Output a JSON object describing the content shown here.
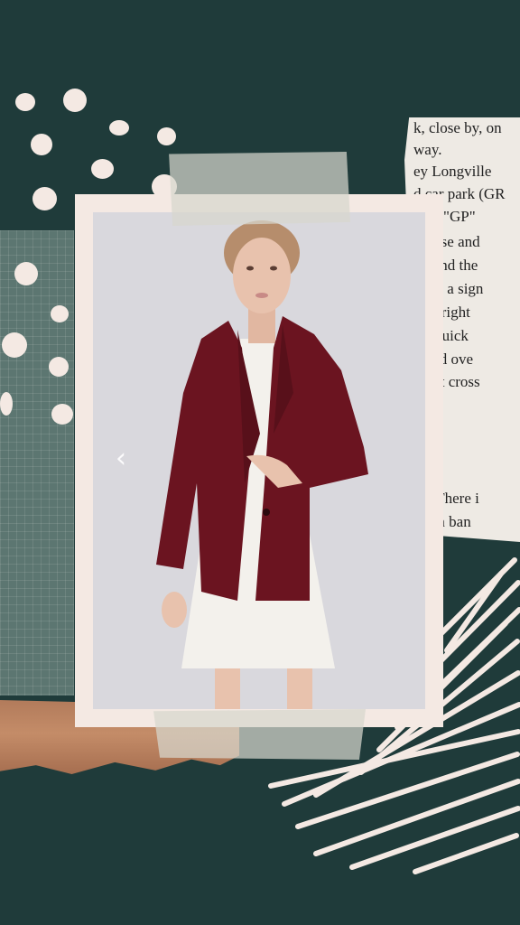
{
  "newspaper": {
    "lines_top": [
      "k, close by, on",
      "way.",
      "ey Longville",
      "d car park (GR",
      "nap, \"GP\"",
      "f these and",
      "ascend the",
      "meet a sign",
      "half right",
      "(in quick",
      "n and ove",
      "o not cross"
    ],
    "lines_bottom": [
      "ge. There i",
      "thern ban"
    ]
  },
  "photo": {
    "icon": "model-in-burgundy-velvet-blazer-photo",
    "colors": {
      "backdrop": "#d9d8dd",
      "blazer": "#6b1420",
      "dress": "#f3f1ec",
      "skin": "#e8c2ad",
      "hair": "#b68d6c"
    }
  },
  "controls": {
    "prev_icon": "chevron-left-icon",
    "prev_glyph": "‹"
  },
  "palette": {
    "background": "#1f3b3a",
    "accent_cream": "#f4e9e3",
    "copper": "#b27b5b",
    "grid_paper": "#5c7671"
  }
}
